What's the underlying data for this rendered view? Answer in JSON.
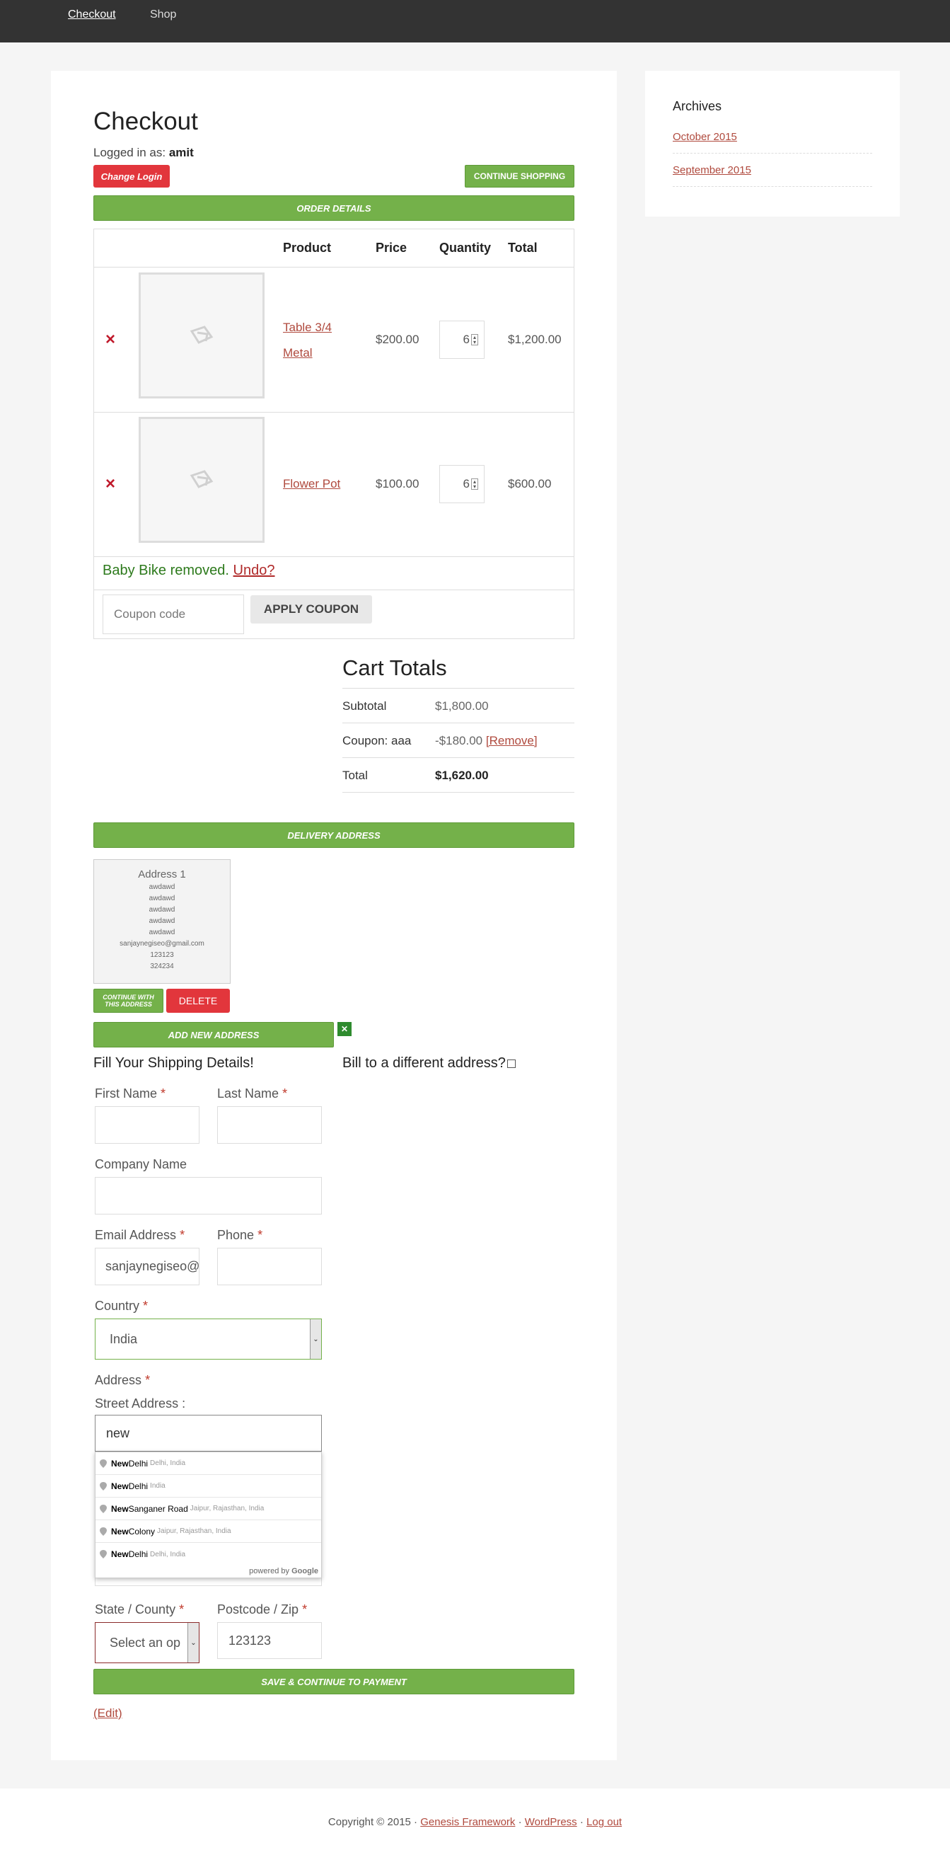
{
  "nav": {
    "checkout": "Checkout",
    "shop": "Shop"
  },
  "page": {
    "title": "Checkout",
    "logged_in_prefix": "Logged in as: ",
    "username": "amit",
    "change_login": "Change Login",
    "continue_shopping": "CONTINUE SHOPPING",
    "order_details": "ORDER DETAILS"
  },
  "cart": {
    "headers": {
      "product": "Product",
      "price": "Price",
      "quantity": "Quantity",
      "total": "Total"
    },
    "items": [
      {
        "name_line1": "Table 3/4",
        "name_line2": "Metal",
        "price": "$200.00",
        "quantity": "6",
        "total": "$1,200.00"
      },
      {
        "name_line1": "Flower Pot",
        "price": "$100.00",
        "quantity": "6",
        "total": "$600.00"
      }
    ],
    "remove_icon": "×",
    "notice": "Baby Bike removed.",
    "undo": "Undo?",
    "coupon_placeholder": "Coupon code",
    "apply_coupon": "APPLY COUPON"
  },
  "totals": {
    "title": "Cart Totals",
    "subtotal_label": "Subtotal",
    "subtotal_value": "$1,800.00",
    "coupon_label": "Coupon: aaa",
    "coupon_value": "-$180.00",
    "coupon_remove": "[Remove]",
    "total_label": "Total",
    "total_value": "$1,620.00"
  },
  "delivery": {
    "bar": "DELIVERY ADDRESS",
    "card_title": "Address 1",
    "card_lines": [
      "awdawd",
      "awdawd",
      "awdawd",
      "awdawd",
      "awdawd",
      "sanjaynegiseo@gmail.com",
      "123123",
      "324234"
    ],
    "continue_with": "CONTINUE WITH THIS ADDRESS",
    "delete": "DELETE",
    "add_new": "ADD NEW ADDRESS",
    "close_icon": "✕"
  },
  "form": {
    "shipping_title": "Fill Your Shipping Details!",
    "bill_different": "Bill to a different address?",
    "first_name": "First Name",
    "last_name": "Last Name",
    "company": "Company Name",
    "email": "Email Address",
    "email_value": "sanjaynegiseo@",
    "phone": "Phone",
    "country": "Country",
    "country_value": "India",
    "address": "Address",
    "street": "Street Address :",
    "street_value": "new",
    "state": "State / County",
    "state_value": "Select an op",
    "postcode": "Postcode / Zip",
    "postcode_value": "123123",
    "required_mark": "*",
    "save_continue": "SAVE & CONTINUE TO PAYMENT",
    "edit": "(Edit)"
  },
  "autocomplete": {
    "items": [
      {
        "match": "New",
        "rest": " Delhi",
        "sub": "Delhi, India"
      },
      {
        "match": "New",
        "rest": " Delhi",
        "sub": "India"
      },
      {
        "match": "New",
        "rest": " Sanganer Road",
        "sub": "Jaipur, Rajasthan, India"
      },
      {
        "match": "New",
        "rest": " Colony",
        "sub": "Jaipur, Rajasthan, India"
      },
      {
        "match": "New",
        "rest": " Delhi",
        "sub": "Delhi, India"
      }
    ],
    "powered_by": "powered by",
    "google": "Google"
  },
  "sidebar": {
    "title": "Archives",
    "links": [
      "October 2015",
      "September 2015"
    ]
  },
  "footer": {
    "copyright": "Copyright © 2015 · ",
    "genesis": "Genesis Framework",
    "sep1": " · ",
    "wordpress": "WordPress",
    "sep2": " · ",
    "logout": "Log out"
  },
  "colors": {
    "accent_green": "#74b14a",
    "danger_red": "#e2363c",
    "link_red": "#c0392b",
    "notice_green": "#2d7a1c",
    "topbar": "#333333"
  }
}
